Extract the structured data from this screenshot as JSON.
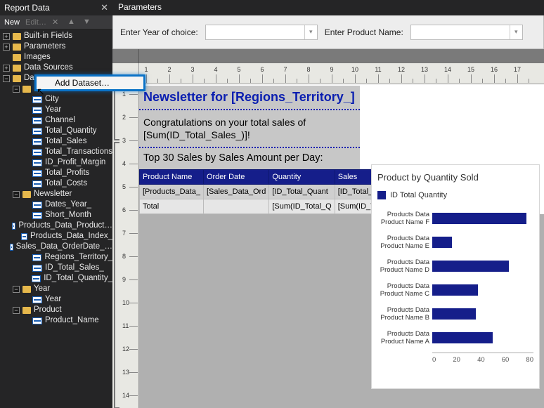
{
  "left_panel": {
    "title": "Report Data",
    "toolbar": {
      "new": "New",
      "edit": "Edit…"
    },
    "tree": {
      "builtin": "Built-in Fields",
      "parameters": "Parameters",
      "images": "Images",
      "data_sources": "Data Sources",
      "datasets": "Datasets",
      "ds1_children": [
        "City",
        "Year",
        "Channel",
        "Total_Quantity",
        "Total_Sales",
        "Total_Transactions",
        "ID_Profit_Margin",
        "Total_Profits",
        "Total_Costs"
      ],
      "newsletter": "Newsletter",
      "newsletter_children": [
        "Dates_Year_",
        "Short_Month",
        "Products_Data_Product…",
        "Products_Data_Index_",
        "Sales_Data_OrderDate_…",
        "Regions_Territory_",
        "ID_Total_Sales_",
        "ID_Total_Quantity_"
      ],
      "year_ds": "Year",
      "year_children": [
        "Year"
      ],
      "product_ds": "Product",
      "product_children": [
        "Product_Name"
      ]
    },
    "context_menu": "Add Dataset…"
  },
  "parameters_panel": {
    "title": "Parameters",
    "p1_label": "Enter Year of choice:",
    "p2_label": "Enter Product Name:"
  },
  "ruler": {
    "h_nums": [
      "1",
      "2",
      "3",
      "4",
      "5",
      "6",
      "7",
      "8",
      "9",
      "10",
      "11",
      "12",
      "13",
      "14",
      "15",
      "16",
      "17"
    ],
    "v_nums": [
      "1",
      "2",
      "3",
      "4",
      "5",
      "6",
      "7",
      "8",
      "9",
      "10",
      "11",
      "12",
      "13",
      "14"
    ]
  },
  "report": {
    "headline": "Newsletter for [Regions_Territory_]",
    "congrats_l1": "Congratulations on your total sales of",
    "congrats_l2": "[Sum(ID_Total_Sales_)]!",
    "subhead": "Top 30 Sales by Sales Amount per Day:",
    "table": {
      "headers": [
        "Product Name",
        "Order Date",
        "Quantity",
        "Sales"
      ],
      "row1": [
        "[Products_Data_",
        "[Sales_Data_Ord",
        "[ID_Total_Quant",
        "[ID_Total_Sales"
      ],
      "total_row": [
        "Total",
        "",
        "[Sum(ID_Total_Q",
        "[Sum(ID_Total_"
      ]
    }
  },
  "chart_data": {
    "type": "bar",
    "title": "Product by Quantity Sold",
    "legend": "ID Total Quantity",
    "categories": [
      "Products Data Product Name  F",
      "Products Data Product Name  E",
      "Products Data Product Name  D",
      "Products Data Product Name  C",
      "Products Data Product Name  B",
      "Products Data Product Name  A"
    ],
    "values": [
      86,
      18,
      70,
      42,
      40,
      55
    ],
    "xlim": [
      0,
      90
    ],
    "x_ticks": [
      "0",
      "20",
      "40",
      "60",
      "80"
    ]
  }
}
